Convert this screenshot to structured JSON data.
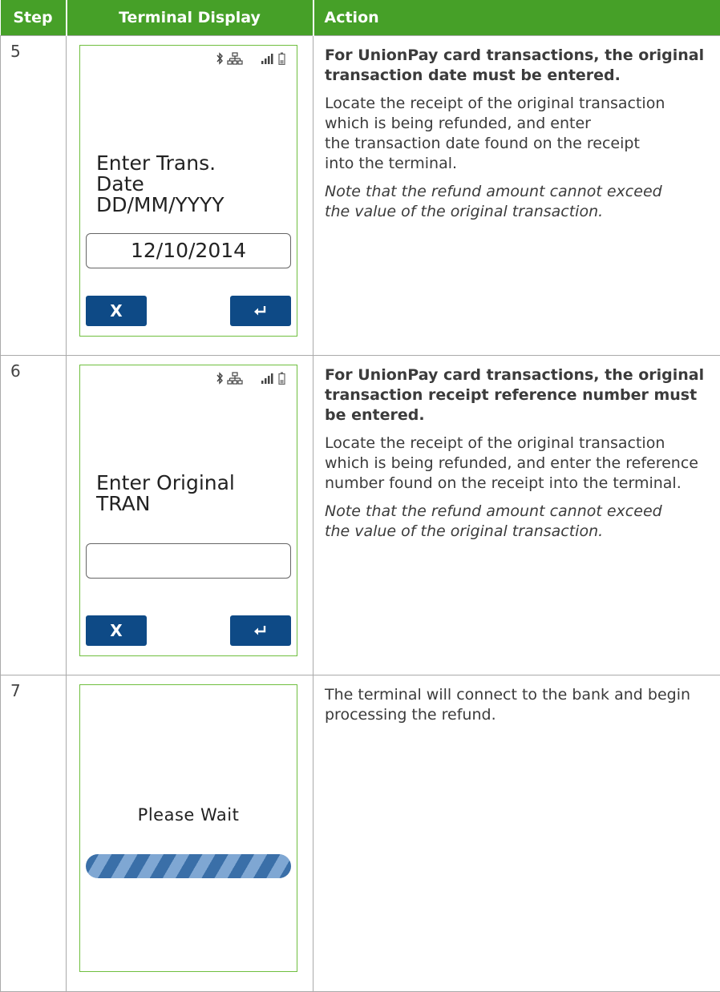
{
  "table": {
    "headers": {
      "step": "Step",
      "display": "Terminal Display",
      "action": "Action"
    },
    "rows": [
      {
        "step": "5",
        "screen": {
          "prompt_lines": [
            "Enter Trans.",
            "Date",
            "DD/MM/YYYY"
          ],
          "entry_value": "12/10/2014",
          "cancel_label": "X"
        },
        "action": {
          "bold": "For UnionPay card transactions, the original transaction date must be entered.",
          "body_lines": [
            "Locate the receipt of the original transaction",
            "which is being refunded, and enter",
            "the transaction date found on the receipt",
            "into the terminal."
          ],
          "note_lines": [
            "Note that the refund amount cannot exceed",
            "the value of the original transaction."
          ]
        }
      },
      {
        "step": "6",
        "screen": {
          "prompt_lines": [
            "Enter Original",
            "TRAN"
          ],
          "entry_value": "",
          "cancel_label": "X"
        },
        "action": {
          "bold": "For UnionPay card transactions, the original transaction receipt reference number must be entered.",
          "body_lines": [
            "Locate the receipt of the original transaction",
            "which is being refunded, and enter the reference",
            "number found on the receipt into the terminal."
          ],
          "note_lines": [
            "Note that the refund amount cannot exceed",
            "the value of the original transaction."
          ]
        }
      },
      {
        "step": "7",
        "screen": {
          "wait_text": "Please Wait",
          "progress": "indeterminate"
        },
        "action": {
          "body_lines": [
            "The terminal will connect to the bank and begin",
            "processing the refund."
          ]
        }
      }
    ]
  },
  "colors": {
    "header_green": "#46a028",
    "screen_border": "#6fbf3f",
    "button_blue": "#0e4a86"
  },
  "icons": [
    "bluetooth-icon",
    "network-icon",
    "signal-strength-icon",
    "battery-icon",
    "enter-key-icon"
  ]
}
